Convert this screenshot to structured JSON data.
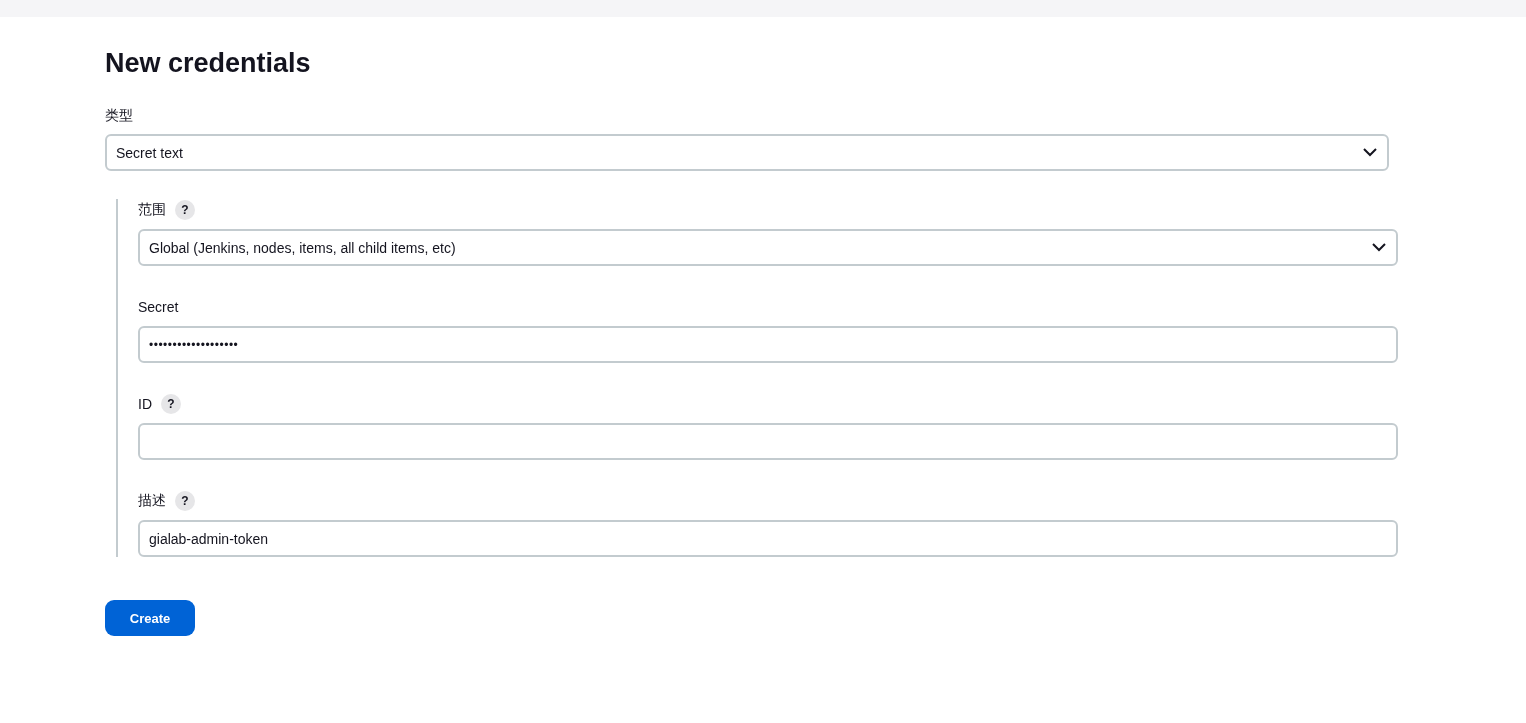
{
  "title": "New credentials",
  "kind_field": {
    "label": "类型",
    "value": "Secret text"
  },
  "fields": [
    {
      "kind": "select",
      "label": "范围",
      "help": "?",
      "value": "Global (Jenkins, nodes, items, all child items, etc)"
    },
    {
      "kind": "password",
      "label": "Secret",
      "value": "•••••••••••••••••••"
    },
    {
      "kind": "text",
      "label": "ID",
      "help": "?"
    },
    {
      "kind": "text",
      "label": "描述",
      "help": "?",
      "value": "gialab-admin-token"
    }
  ],
  "submit": "Create"
}
